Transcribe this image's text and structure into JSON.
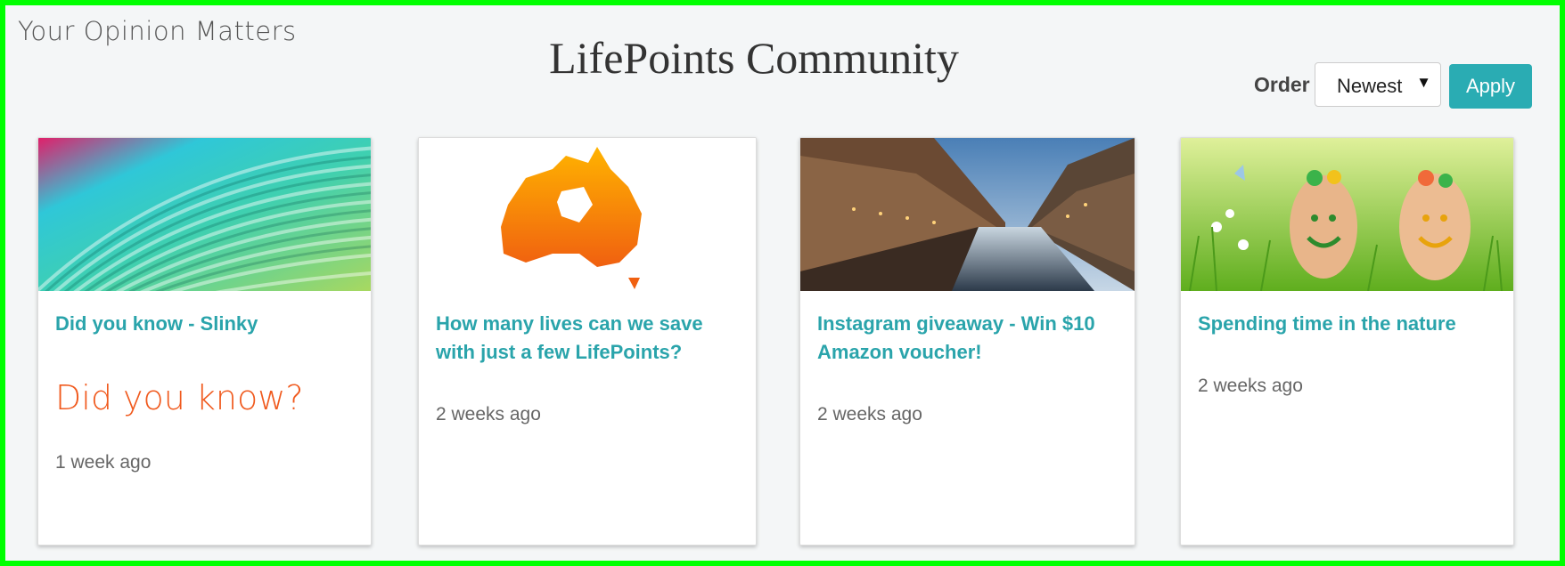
{
  "header": {
    "tagline": "Your Opinion Matters",
    "title": "LifePoints Community"
  },
  "controls": {
    "order_label": "Order",
    "order_value": "Newest",
    "apply_label": "Apply"
  },
  "cards": [
    {
      "title": "Did you know - Slinky",
      "teaser": "Did you know?",
      "time": "1 week ago",
      "image": "colorful-slinky-spiral"
    },
    {
      "title": "How many lives can we save with just a few LifePoints?",
      "time": "2 weeks ago",
      "image": "orange-australia-map"
    },
    {
      "title": "Instagram giveaway - Win $10 Amazon voucher!",
      "time": "2 weeks ago",
      "image": "city-canal-at-dusk"
    },
    {
      "title": "Spending time in the nature",
      "time": "2 weeks ago",
      "image": "painted-smiley-feet-in-grass"
    }
  ],
  "colors": {
    "accent": "#2aacb3",
    "title_text": "#2aa4ab",
    "teaser": "#f05a1e",
    "frame": "#00ff00"
  }
}
